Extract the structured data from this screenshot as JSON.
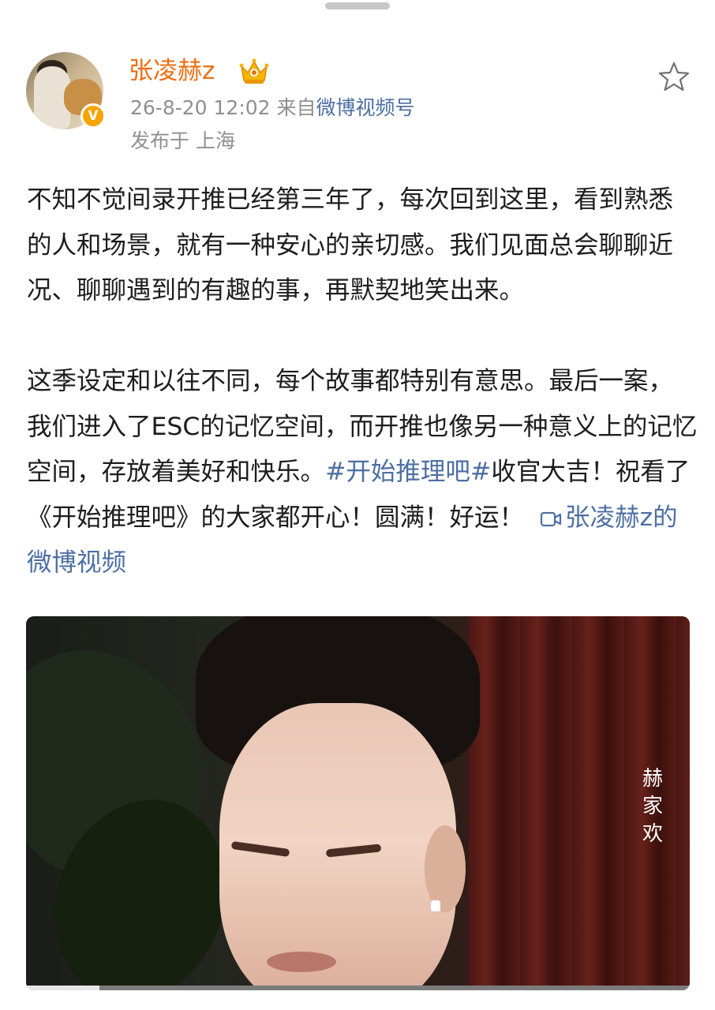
{
  "header": {
    "username": "张凌赫z",
    "timestamp": "26-8-20 12:02",
    "source_prefix": "来自",
    "source": "微博视频号",
    "location": "发布于 上海",
    "icons": {
      "crown": "crown-badge-icon",
      "verify": "verified-v-icon",
      "favorite": "star-icon"
    },
    "verify_mark": "V",
    "colors": {
      "username": "#ef6d10",
      "link": "#4d6fa3",
      "meta": "#8f8f8f",
      "verify": "#f7a400"
    }
  },
  "post": {
    "paragraph1": "不知不觉间录开推已经第三年了，每次回到这里，看到熟悉的人和场景，就有一种安心的亲切感。我们见面总会聊聊近况、聊聊遇到的有趣的事，再默契地笑出来。",
    "paragraph2_text": "这季设定和以往不同，每个故事都特别有意思。最后一案，我们进入了ESC的记忆空间，而开推也像另一种意义上的记忆空间，存放着美好和快乐。",
    "hashtag": "#开始推理吧#",
    "paragraph2_tail": "收官大吉！祝看了《开始推理吧》的大家都开心！圆满！好运！",
    "video_link": "张凌赫z的微博视频"
  },
  "video": {
    "caption": "赫\n家\n欢",
    "progress": 0.11
  }
}
